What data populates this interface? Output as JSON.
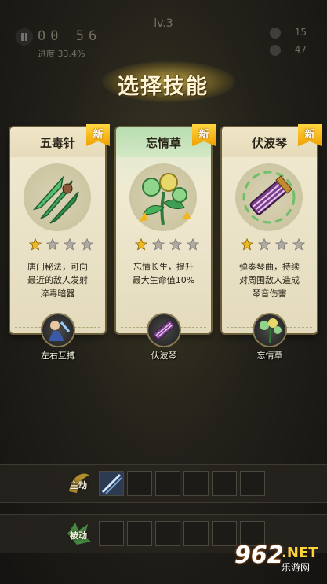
{
  "hud": {
    "level": "lv.3",
    "timer": "00 56",
    "progress": "进度 33.4%",
    "coins": "15",
    "kills": "47"
  },
  "title": "选择技能",
  "cards": [
    {
      "name": "五毒针",
      "badge": "新",
      "stars_filled": 1,
      "stars_total": 4,
      "desc_lines": [
        "唐门秘法，可向",
        "最近的敌人发射",
        "淬毒暗器"
      ],
      "sub_label": "左右互搏",
      "icon": "poison-needles-icon",
      "sub_icon": "dual-fighter-icon"
    },
    {
      "name": "忘情草",
      "badge": "新",
      "stars_filled": 1,
      "stars_total": 4,
      "desc_lines": [
        "忘情长生，提升",
        "最大生命值10%"
      ],
      "sub_label": "伏波琴",
      "icon": "herb-plant-icon",
      "sub_icon": "zither-icon"
    },
    {
      "name": "伏波琴",
      "badge": "新",
      "stars_filled": 1,
      "stars_total": 4,
      "desc_lines": [
        "弹奏琴曲，持续",
        "对周围敌人造成",
        "琴音伤害"
      ],
      "sub_label": "忘情草",
      "icon": "zither-icon",
      "sub_icon": "herb-plant-icon"
    }
  ],
  "skill_bars": {
    "active_label": "主动",
    "passive_label": "被动",
    "active_slots": 6,
    "passive_slots": 6
  },
  "watermark": {
    "number": "962",
    "net": ".NET",
    "site": "乐游网"
  },
  "colors": {
    "star_filled": "#f0b820",
    "star_empty": "#b0aaa0",
    "badge": "#f5b800"
  }
}
